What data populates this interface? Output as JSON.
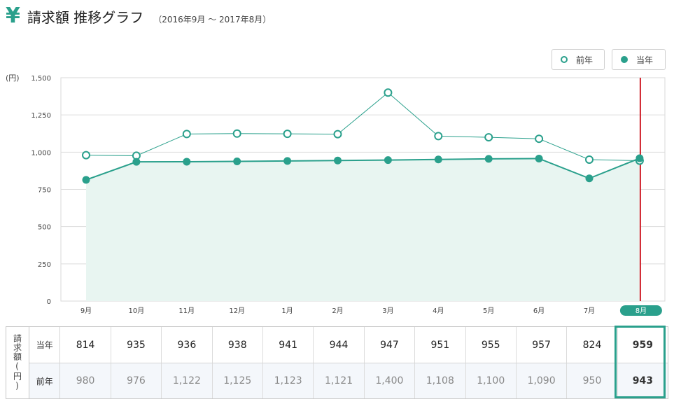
{
  "header": {
    "currency_icon": "¥",
    "title": "請求額 推移グラフ",
    "period": "（2016年9月 ～ 2017年8月）"
  },
  "legend": {
    "prev_label": "前年",
    "curr_label": "当年"
  },
  "colors": {
    "accent": "#2aa08c",
    "fill": "#e8f5f1",
    "marker_line": "#d0202a",
    "grid": "#dddddd"
  },
  "table": {
    "vertical_header": "請求額(円)",
    "curr_label": "当年",
    "prev_label": "前年",
    "curr_values": [
      "814",
      "935",
      "936",
      "938",
      "941",
      "944",
      "947",
      "951",
      "955",
      "957",
      "824",
      "959"
    ],
    "prev_values": [
      "980",
      "976",
      "1,122",
      "1,125",
      "1,123",
      "1,121",
      "1,400",
      "1,108",
      "1,100",
      "1,090",
      "950",
      "943"
    ]
  },
  "chart_data": {
    "type": "line",
    "unit_label": "(円)",
    "categories": [
      "9月",
      "10月",
      "11月",
      "12月",
      "1月",
      "2月",
      "3月",
      "4月",
      "5月",
      "6月",
      "7月",
      "8月"
    ],
    "series": [
      {
        "name": "当年",
        "values": [
          814,
          935,
          936,
          938,
          941,
          944,
          947,
          951,
          955,
          957,
          824,
          959
        ],
        "style": "solid-area"
      },
      {
        "name": "前年",
        "values": [
          980,
          976,
          1122,
          1125,
          1123,
          1121,
          1400,
          1108,
          1100,
          1090,
          950,
          943
        ],
        "style": "hollow"
      }
    ],
    "ylim": [
      0,
      1500
    ],
    "yticks": [
      0,
      250,
      500,
      750,
      1000,
      1250,
      1500
    ],
    "ytick_labels": [
      "0",
      "250",
      "500",
      "750",
      "1,000",
      "1,250",
      "1,500"
    ],
    "highlight_category": "8月",
    "grid": true
  }
}
